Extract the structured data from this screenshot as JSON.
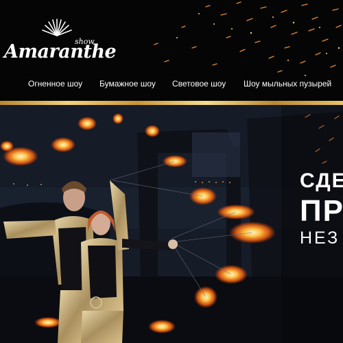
{
  "logo": {
    "show": "show",
    "name": "Amaranthe"
  },
  "nav": {
    "items": [
      {
        "label": "Огненное шоу"
      },
      {
        "label": "Бумажное шоу"
      },
      {
        "label": "Световое шоу"
      },
      {
        "label": "Шоу мыльных пузырей"
      }
    ]
  },
  "hero": {
    "line1": "СДЕ",
    "line2": "ПР",
    "line3": "НЕЗ"
  },
  "colors": {
    "gold": "#d9ad4f",
    "fire": "#ff9a2e",
    "background": "#050505"
  }
}
